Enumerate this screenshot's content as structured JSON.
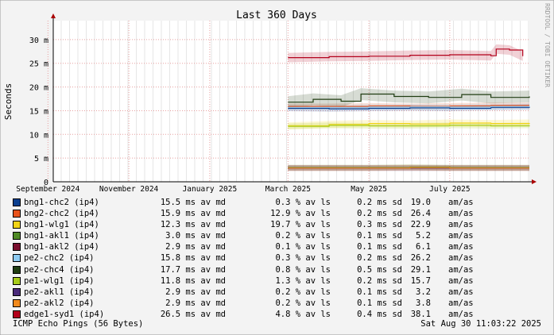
{
  "chart_data": {
    "type": "line",
    "title": "Last 360 Days",
    "ylabel": "Seconds",
    "watermark": "RRDTOOL / TOBI OETIKER",
    "ylim": [
      0,
      0.034
    ],
    "y_ticks": [
      {
        "value": 0,
        "label": "0"
      },
      {
        "value": 0.005,
        "label": "5 m"
      },
      {
        "value": 0.01,
        "label": "10 m"
      },
      {
        "value": 0.015,
        "label": "15 m"
      },
      {
        "value": 0.02,
        "label": "20 m"
      },
      {
        "value": 0.025,
        "label": "25 m"
      },
      {
        "value": 0.03,
        "label": "30 m"
      }
    ],
    "xlim": [
      "2024-09-05",
      "2025-08-30"
    ],
    "x_ticks": [
      {
        "date": "2024-09-01",
        "label": "September 2024"
      },
      {
        "date": "2024-11-01",
        "label": "November 2024"
      },
      {
        "date": "2025-01-01",
        "label": "January 2025"
      },
      {
        "date": "2025-03-01",
        "label": "March 2025"
      },
      {
        "date": "2025-05-01",
        "label": "May 2025"
      },
      {
        "date": "2025-07-01",
        "label": "July 2025"
      }
    ],
    "data_start": "2025-03-01",
    "series": [
      {
        "name": "bng1-chc2 (ip4)",
        "color": "#0b3f8f",
        "median": "15.5 ms av md",
        "loss": "0.3 % av ls",
        "sd": "0.2 ms sd",
        "max": "19.0",
        "unit": "am/as",
        "x": [
          "2025-03-01",
          "2025-04-01",
          "2025-05-01",
          "2025-06-01",
          "2025-07-01",
          "2025-08-01",
          "2025-08-30"
        ],
        "y": [
          0.0155,
          0.0154,
          0.0155,
          0.0156,
          0.0155,
          0.0157,
          0.0158
        ]
      },
      {
        "name": "bng2-chc2 (ip4)",
        "color": "#e8531c",
        "median": "15.9 ms av md",
        "loss": "12.9 % av ls",
        "sd": "0.2 ms sd",
        "max": "26.4",
        "unit": "am/as",
        "x": [
          "2025-03-01",
          "2025-04-01",
          "2025-05-01",
          "2025-06-01",
          "2025-07-01",
          "2025-08-01",
          "2025-08-30"
        ],
        "y": [
          0.0159,
          0.0159,
          0.016,
          0.0159,
          0.016,
          0.0161,
          0.0161
        ]
      },
      {
        "name": "bng1-wlg1 (ip4)",
        "color": "#f2d416",
        "median": "12.3 ms av md",
        "loss": "19.7 % av ls",
        "sd": "0.3 ms sd",
        "max": "22.9",
        "unit": "am/as",
        "x": [
          "2025-03-01",
          "2025-04-01",
          "2025-05-01",
          "2025-06-01",
          "2025-07-01",
          "2025-08-01",
          "2025-08-30"
        ],
        "y": [
          0.0118,
          0.0121,
          0.0123,
          0.0122,
          0.0124,
          0.0123,
          0.0124
        ]
      },
      {
        "name": "bng1-akl1 (ip4)",
        "color": "#4f8a25",
        "median": "3.0 ms av md",
        "loss": "0.2 % av ls",
        "sd": "0.1 ms sd",
        "max": "5.2",
        "unit": "am/as",
        "x": [
          "2025-03-01",
          "2025-04-01",
          "2025-05-01",
          "2025-06-01",
          "2025-07-01",
          "2025-08-01",
          "2025-08-30"
        ],
        "y": [
          0.003,
          0.003,
          0.003,
          0.0031,
          0.003,
          0.003,
          0.003
        ]
      },
      {
        "name": "bng1-akl2 (ip4)",
        "color": "#7a0e2e",
        "median": "2.9 ms av md",
        "loss": "0.1 % av ls",
        "sd": "0.1 ms sd",
        "max": "6.1",
        "unit": "am/as",
        "x": [
          "2025-03-01",
          "2025-04-01",
          "2025-05-01",
          "2025-06-01",
          "2025-07-01",
          "2025-08-01",
          "2025-08-30"
        ],
        "y": [
          0.0029,
          0.0029,
          0.0029,
          0.0029,
          0.0029,
          0.0029,
          0.0029
        ]
      },
      {
        "name": "pe2-chc2 (ip4)",
        "color": "#8ecbf2",
        "median": "15.8 ms av md",
        "loss": "0.3 % av ls",
        "sd": "0.2 ms sd",
        "max": "26.2",
        "unit": "am/as",
        "x": [
          "2025-03-01",
          "2025-04-01",
          "2025-05-01",
          "2025-06-01",
          "2025-07-01",
          "2025-08-01",
          "2025-08-30"
        ],
        "y": [
          0.0157,
          0.0157,
          0.0158,
          0.0158,
          0.0158,
          0.0159,
          0.016
        ]
      },
      {
        "name": "pe2-chc4 (ip4)",
        "color": "#203d12",
        "median": "17.7 ms av md",
        "loss": "0.8 % av ls",
        "sd": "0.5 ms sd",
        "max": "29.1",
        "unit": "am/as",
        "x": [
          "2025-03-01",
          "2025-03-20",
          "2025-04-10",
          "2025-04-25",
          "2025-05-20",
          "2025-06-15",
          "2025-07-10",
          "2025-08-01",
          "2025-08-30"
        ],
        "y": [
          0.0168,
          0.0174,
          0.017,
          0.0185,
          0.018,
          0.0178,
          0.0184,
          0.0178,
          0.018
        ]
      },
      {
        "name": "pe1-wlg1 (ip4)",
        "color": "#a8cc1c",
        "median": "11.8 ms av md",
        "loss": "1.3 % av ls",
        "sd": "0.2 ms sd",
        "max": "15.7",
        "unit": "am/as",
        "x": [
          "2025-03-01",
          "2025-04-01",
          "2025-05-01",
          "2025-06-01",
          "2025-07-01",
          "2025-08-01",
          "2025-08-30"
        ],
        "y": [
          0.0117,
          0.0119,
          0.0118,
          0.0118,
          0.0119,
          0.0118,
          0.0119
        ]
      },
      {
        "name": "pe2-akl1 (ip4)",
        "color": "#4a2a7a",
        "median": "2.9 ms av md",
        "loss": "0.2 % av ls",
        "sd": "0.1 ms sd",
        "max": "3.2",
        "unit": "am/as",
        "x": [
          "2025-03-01",
          "2025-04-01",
          "2025-05-01",
          "2025-06-01",
          "2025-07-01",
          "2025-08-01",
          "2025-08-30"
        ],
        "y": [
          0.0029,
          0.0029,
          0.0029,
          0.0029,
          0.0029,
          0.0029,
          0.0029
        ]
      },
      {
        "name": "pe2-akl2 (ip4)",
        "color": "#f28a1c",
        "median": "2.9 ms av md",
        "loss": "0.2 % av ls",
        "sd": "0.1 ms sd",
        "max": "3.8",
        "unit": "am/as",
        "x": [
          "2025-03-01",
          "2025-04-01",
          "2025-05-01",
          "2025-06-01",
          "2025-07-01",
          "2025-08-01",
          "2025-08-30"
        ],
        "y": [
          0.0029,
          0.0029,
          0.0029,
          0.003,
          0.0029,
          0.0029,
          0.0029
        ]
      },
      {
        "name": "edge1-syd1 (ip4)",
        "color": "#b3001b",
        "median": "26.5 ms av md",
        "loss": "4.8 % av ls",
        "sd": "0.4 ms sd",
        "max": "38.1",
        "unit": "am/as",
        "x": [
          "2025-03-01",
          "2025-04-01",
          "2025-05-01",
          "2025-06-01",
          "2025-07-01",
          "2025-08-01",
          "2025-08-05",
          "2025-08-15",
          "2025-08-25"
        ],
        "y": [
          0.0262,
          0.0264,
          0.0265,
          0.0267,
          0.0268,
          0.0266,
          0.028,
          0.0278,
          0.0265
        ]
      }
    ]
  },
  "footer": {
    "probe": "ICMP Echo Pings (56 Bytes)",
    "timestamp": "Sat Aug 30 11:03:22 2025"
  }
}
